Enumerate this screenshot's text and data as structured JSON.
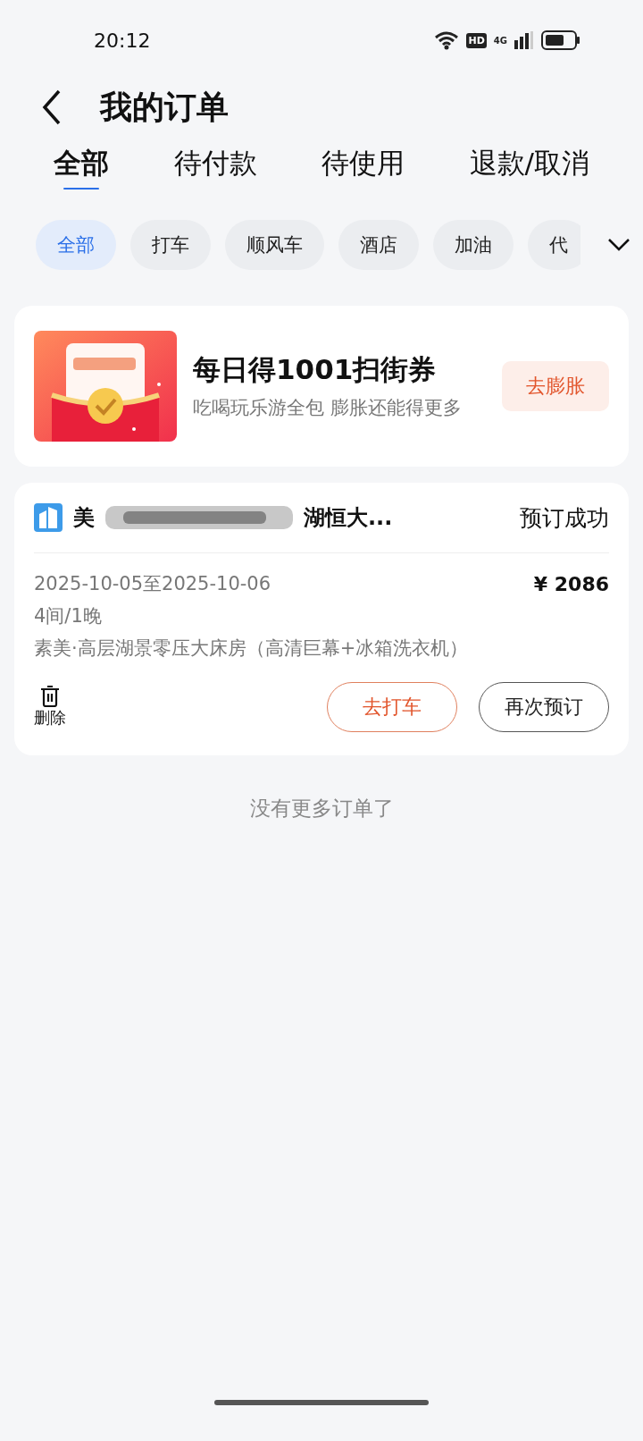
{
  "status_bar": {
    "time": "20:12",
    "hd": "HD",
    "network": "4G"
  },
  "header": {
    "title": "我的订单"
  },
  "tabs": [
    {
      "label": "全部",
      "selected": true
    },
    {
      "label": "待付款",
      "selected": false
    },
    {
      "label": "待使用",
      "selected": false
    },
    {
      "label": "退款/取消",
      "selected": false
    }
  ],
  "chips": [
    {
      "label": "全部",
      "selected": true
    },
    {
      "label": "打车",
      "selected": false
    },
    {
      "label": "顺风车",
      "selected": false
    },
    {
      "label": "酒店",
      "selected": false
    },
    {
      "label": "加油",
      "selected": false
    },
    {
      "label": "代",
      "selected": false
    }
  ],
  "promo": {
    "title": "每日得1001扫街券",
    "subtitle": "吃喝玩乐游全包 膨胀还能得更多",
    "button": "去膨胀"
  },
  "order": {
    "name_start": "美",
    "name_end": "湖恒大...",
    "name_redacted": true,
    "status": "预订成功",
    "dates": "2025-10-05至2025-10-06",
    "price": "¥ 2086",
    "rooms": "4间/1晚",
    "room_type": "素美·高层湖景零压大床房（高清巨幕+冰箱洗衣机）",
    "delete": "删除",
    "buttons": [
      {
        "label": "去打车",
        "kind": "primary"
      },
      {
        "label": "再次预订",
        "kind": "secondary"
      }
    ]
  },
  "footer_note": "没有更多订单了"
}
